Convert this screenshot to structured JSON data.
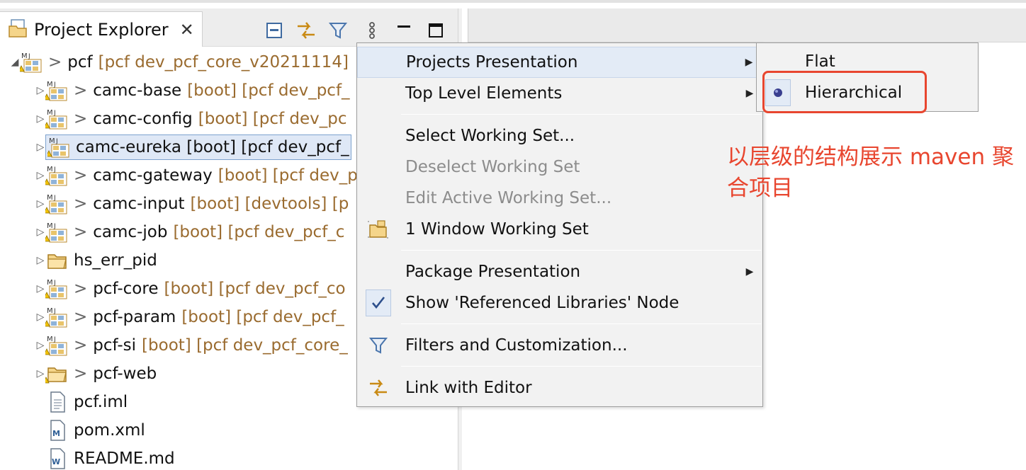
{
  "view": {
    "title": "Project Explorer",
    "close_glyph": "✕"
  },
  "toolbar": {
    "collapse_all": "collapse-all-icon",
    "link_editor": "link-with-editor-icon",
    "filter": "filter-icon",
    "view_menu": "view-menu-icon",
    "minimize": "minimize-icon",
    "maximize": "maximize-icon"
  },
  "tree": {
    "rows": [
      {
        "arrow": "◢",
        "gt": ">",
        "name": "pcf",
        "deco": "[pcf dev_pcf_core_v20211114]",
        "icon": "maven-project-icon"
      },
      {
        "arrow": "▷",
        "gt": ">",
        "name": "camc-base",
        "deco": "[boot] [pcf dev_pcf_",
        "icon": "maven-project-icon"
      },
      {
        "arrow": "▷",
        "gt": ">",
        "name": "camc-config",
        "deco": "[boot] [pcf dev_pc",
        "icon": "maven-project-icon"
      },
      {
        "arrow": "▷",
        "gt": "",
        "name": "camc-eureka [boot] [pcf dev_pcf_",
        "deco": "",
        "icon": "maven-project-icon",
        "selected": true
      },
      {
        "arrow": "▷",
        "gt": ">",
        "name": "camc-gateway",
        "deco": "[boot] [pcf dev_p",
        "icon": "maven-project-icon"
      },
      {
        "arrow": "▷",
        "gt": ">",
        "name": "camc-input",
        "deco": "[boot] [devtools] [p",
        "icon": "maven-project-icon"
      },
      {
        "arrow": "▷",
        "gt": ">",
        "name": "camc-job",
        "deco": "[boot] [pcf dev_pcf_c",
        "icon": "maven-project-icon"
      },
      {
        "arrow": "▷",
        "gt": "",
        "name": "hs_err_pid",
        "deco": "",
        "icon": "folder-icon"
      },
      {
        "arrow": "▷",
        "gt": ">",
        "name": "pcf-core",
        "deco": "[boot] [pcf dev_pcf_co",
        "icon": "maven-project-icon"
      },
      {
        "arrow": "▷",
        "gt": ">",
        "name": "pcf-param",
        "deco": "[boot] [pcf dev_pcf_",
        "icon": "maven-project-icon"
      },
      {
        "arrow": "▷",
        "gt": ">",
        "name": "pcf-si",
        "deco": "[boot] [pcf dev_pcf_core_",
        "icon": "maven-project-icon"
      },
      {
        "arrow": "▷",
        "gt": ">",
        "name": "pcf-web",
        "deco": "",
        "icon": "folder-icon"
      },
      {
        "arrow": "",
        "gt": "",
        "name": "pcf.iml",
        "deco": "",
        "icon": "file-icon"
      },
      {
        "arrow": "",
        "gt": "",
        "name": "pom.xml",
        "deco": "",
        "icon": "xml-file-icon"
      },
      {
        "arrow": "",
        "gt": "",
        "name": "README.md",
        "deco": "",
        "icon": "markdown-file-icon"
      }
    ]
  },
  "menu": {
    "items": [
      {
        "label": "Projects Presentation",
        "submenu": "▶",
        "highlight": true
      },
      {
        "label": "Top Level Elements",
        "submenu": "▶"
      },
      {
        "label": "Select Working Set..."
      },
      {
        "label": "Deselect Working Set",
        "disabled": true
      },
      {
        "label": "Edit Active Working Set...",
        "disabled": true
      },
      {
        "label": "1 Window Working Set",
        "icon": "working-set-icon"
      },
      {
        "label": "Package Presentation",
        "submenu": "▶"
      },
      {
        "label": "Show 'Referenced Libraries' Node",
        "icon": "checkmark-icon"
      },
      {
        "label": "Filters and Customization...",
        "icon": "filter-icon"
      },
      {
        "label": "Link with Editor",
        "icon": "link-with-editor-icon"
      }
    ]
  },
  "submenu": {
    "items": [
      {
        "label": "Flat"
      },
      {
        "label": "Hierarchical",
        "icon": "radio-selected-icon"
      }
    ]
  },
  "annotation": {
    "text": "以层级的结构展示 maven 聚合项目"
  },
  "colors": {
    "annotation_red": "#e8462f",
    "selection_bg": "#dfe8f6",
    "decoration_brown": "#9a6b2f"
  }
}
